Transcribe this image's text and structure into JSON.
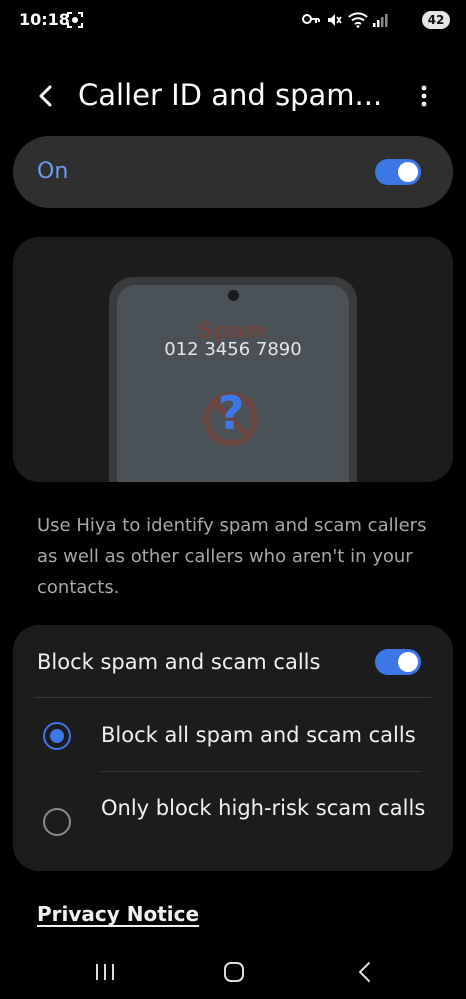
{
  "status_bar": {
    "time": "10:18",
    "battery_level": "42",
    "icons": [
      "screenshot-icon",
      "vpn-key-icon",
      "mute-icon",
      "wifi-icon",
      "signal-icon"
    ]
  },
  "header": {
    "title": "Caller ID and spam..."
  },
  "master_toggle": {
    "label": "On",
    "enabled": true
  },
  "illustration": {
    "spam_text": "Spam",
    "phone_number": "012 3456 7890",
    "icon": "question-block-icon"
  },
  "description": "Use Hiya to identify spam and scam callers as well as other callers who aren't in your contacts.",
  "block_section": {
    "title": "Block spam and scam calls",
    "enabled": true,
    "options": [
      {
        "label": "Block all spam and scam calls",
        "selected": true
      },
      {
        "label": "Only block high-risk scam calls",
        "selected": false
      }
    ]
  },
  "privacy_link": "Privacy Notice",
  "nav_bar": {
    "icons": [
      "recent-apps-icon",
      "home-icon",
      "back-icon"
    ]
  },
  "colors": {
    "accent": "#3d76e6",
    "card_background": "#1c1c1c",
    "toggle_card_background": "#2f2f2f",
    "on_label": "#6a9cf0"
  }
}
